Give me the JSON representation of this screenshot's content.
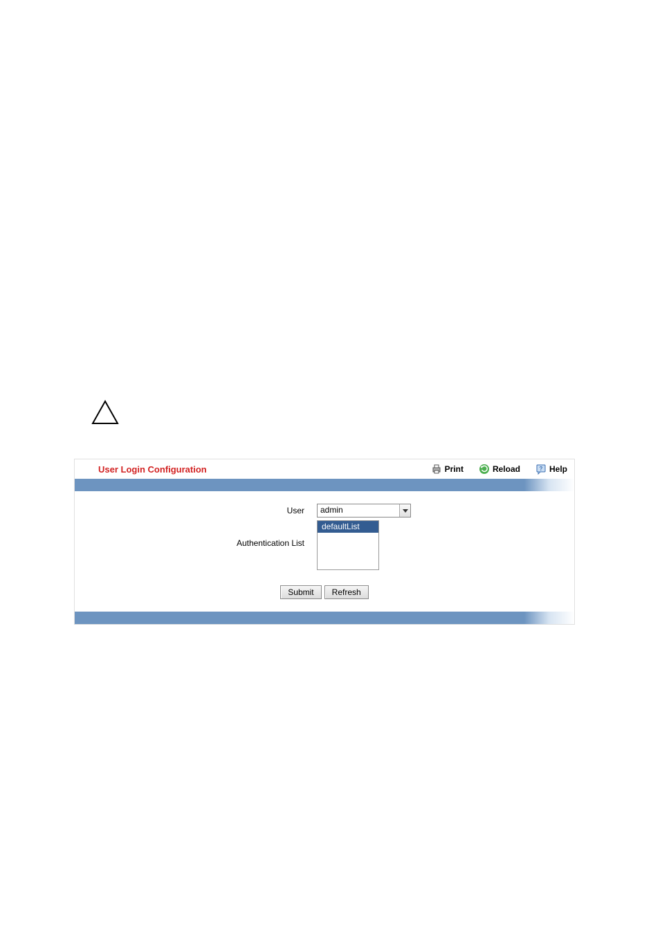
{
  "panel": {
    "title": "User Login Configuration"
  },
  "header_links": {
    "print": "Print",
    "reload": "Reload",
    "help": "Help"
  },
  "form": {
    "user_label": "User",
    "user_value": "admin",
    "auth_list_label": "Authentication List",
    "auth_list_items": [
      "defaultList"
    ]
  },
  "buttons": {
    "submit": "Submit",
    "refresh": "Refresh"
  }
}
